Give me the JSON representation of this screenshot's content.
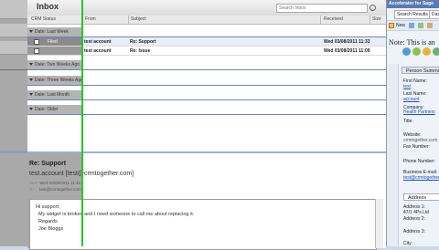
{
  "list": {
    "title": "Inbox",
    "search_placeholder": "Search Inbox",
    "columns": [
      "CRM Status",
      "From",
      "Subject",
      "Received",
      "Size"
    ],
    "groups": [
      {
        "label": "Date: Last Week"
      },
      {
        "label": "Date: Two Weeks Ago"
      },
      {
        "label": "Date: Three Weeks Ago"
      },
      {
        "label": "Date: Last Month"
      },
      {
        "label": "Date: Older"
      }
    ],
    "messages": [
      {
        "flag": "Filed",
        "from": "test account",
        "subject": "Re: Support",
        "received": "Wed 03/08/2011 11:33"
      },
      {
        "flag": "",
        "from": "test account",
        "subject": "Re: Issue",
        "received": "Wed 03/08/2011 11:09"
      }
    ]
  },
  "reading": {
    "subject": "Re: Support",
    "from": "test.account [test@crmtogether.com]",
    "sent_label": "Sent",
    "sent_value": "Wed 03/08/2011 11:33",
    "to_label": "To",
    "to_value": "test@crmtogether.com",
    "body_lines": [
      "Hi support,",
      "My widget is broken and I need someone to call me about replacing it.",
      "Regards",
      "Joe Bloggs"
    ]
  },
  "panel": {
    "header": "Accelerator for Sage",
    "tabs": [
      "Search Results",
      "Dashboard"
    ],
    "toolbar_new": "New",
    "note": "Note: This is an",
    "person_summary": "Person Summary",
    "fields": [
      {
        "text": "First Name:",
        "style": "label"
      },
      {
        "text": "test",
        "style": "link"
      },
      {
        "text": "Last Name:",
        "style": "label"
      },
      {
        "text": "account",
        "style": "link"
      },
      {
        "text": "Company:",
        "style": "label"
      },
      {
        "text": "Health Partners",
        "style": "link"
      },
      {
        "text": "Title:",
        "style": "label"
      },
      {
        "text": "Website:",
        "style": "label"
      },
      {
        "text": "crmtogether.com",
        "style": "muted"
      },
      {
        "text": "Fax Number:",
        "style": "label"
      },
      {
        "text": "Phone Number:",
        "style": "label"
      },
      {
        "text": "Business E-mail:",
        "style": "label"
      },
      {
        "text": "test@crmtogether.",
        "style": "link"
      }
    ],
    "address_tab": "Address",
    "address_lines": [
      "Address 1:",
      "47/1 4Ps Ltd",
      "Address 2:",
      "Address 3:",
      "City:"
    ]
  }
}
